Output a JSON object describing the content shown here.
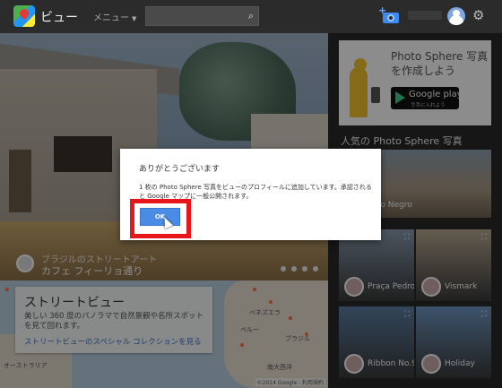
{
  "header": {
    "app_title": "ビュー",
    "menu_label": "メニュー",
    "search_placeholder": "",
    "search_icon": "search-icon",
    "camera_icon": "add-photo-camera-icon",
    "settings_icon": "gear-icon"
  },
  "panorama": {
    "credit_line1": "ブラジルのストリートアート",
    "credit_line2": "カフェ フィーリョ通り",
    "pager_dots": 4
  },
  "streetview_card": {
    "title": "ストリートビュー",
    "description": "美しい 360 度のパノラマで自然景観や名所スポットを見て回れます。",
    "link": "ストリートビューのスペシャル コレクションを見る"
  },
  "map": {
    "labels": [
      "ベネズエラ",
      "ペルー",
      "ブラジル",
      "南大西洋",
      "オーストラリア"
    ],
    "attribution": "©2014 Google - 利用規約"
  },
  "sidebar": {
    "promo_text": "Photo Sphere 写真を作成しよう",
    "gplay_line1": "Google play",
    "gplay_line2": "で手に入れよう",
    "popular_title": "人気の Photo Sphere 写真",
    "popular_caption": "Mosquero Negro",
    "thumbs": [
      {
        "caption": "Praça Pedro",
        "color": "#8a9bb0"
      },
      {
        "caption": "Vismark",
        "color": "#b7aa92"
      },
      {
        "caption": "Ribbon No.9",
        "color": "#5c7fa3"
      },
      {
        "caption": "Holiday",
        "color": "#6f98c2"
      }
    ]
  },
  "dialog": {
    "title": "ありがとうございます",
    "message": "1 枚の Photo Sphere 写真をビューのプロフィールに追加しています。承認されると Google マップに一般公開されます。",
    "ok_label": "OK",
    "highlight_color": "#e8161a",
    "button_color": "#4a8be6"
  }
}
